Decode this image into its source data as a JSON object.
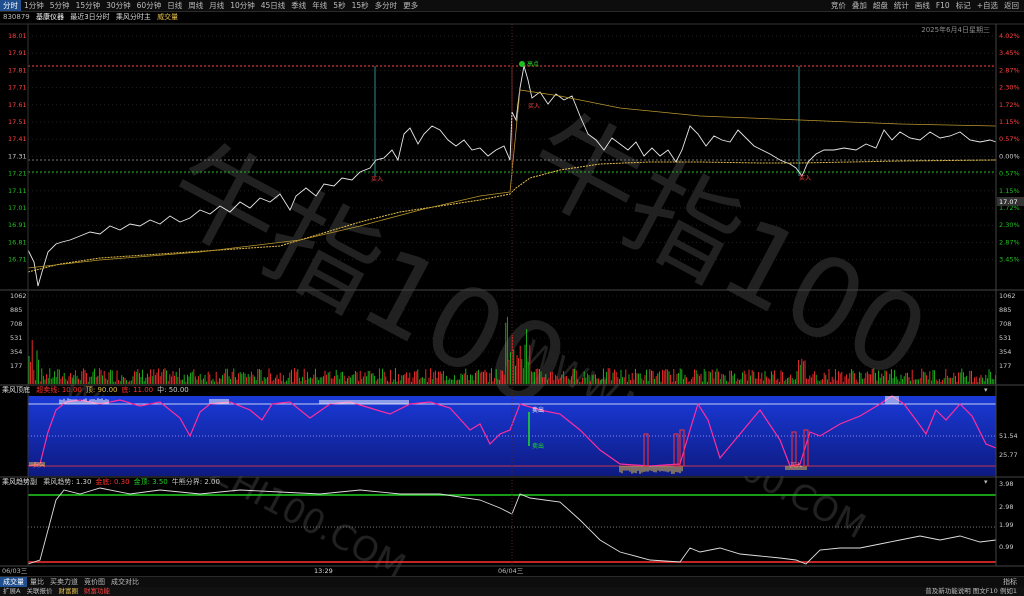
{
  "toolbar": {
    "tabs": [
      "分时",
      "1分钟",
      "5分钟",
      "15分钟",
      "30分钟",
      "60分钟",
      "日线",
      "周线",
      "月线",
      "10分钟",
      "45日线",
      "季线",
      "年线",
      "5秒",
      "15秒",
      "多分时",
      "更多"
    ],
    "active_tab": "分时",
    "right_buttons": [
      "竞价",
      "叠加",
      "超盘",
      "统计",
      "画线",
      "F10",
      "标记",
      "+自选",
      "返回"
    ]
  },
  "info": {
    "code": "830879",
    "name": "基康仪器",
    "period": "最近3日分时",
    "indicator_name": "乘风分时主",
    "indicator_vol": "威交量"
  },
  "date_caption": "2025年6月4日星期三",
  "price_axis": {
    "left": [
      "18.01",
      "17.91",
      "17.81",
      "17.71",
      "17.61",
      "17.51",
      "17.41",
      "17.31",
      "17.21",
      "17.11",
      "17.01",
      "16.91",
      "16.81",
      "16.71"
    ],
    "right": [
      "4.02%",
      "3.45%",
      "2.87%",
      "2.30%",
      "1.72%",
      "1.15%",
      "0.57%",
      "0.00%",
      "0.57%",
      "1.15%",
      "1.72%",
      "2.30%",
      "2.87%",
      "3.45%"
    ],
    "right_colors": [
      "#ff4040",
      "#ff4040",
      "#ff4040",
      "#ff4040",
      "#ff4040",
      "#ff4040",
      "#ff4040",
      "#cccccc",
      "#20c020",
      "#20c020",
      "#20c020",
      "#20c020",
      "#20c020",
      "#20c020"
    ],
    "current_price": "17.07"
  },
  "volume_axis": {
    "left": [
      "1062",
      "885",
      "708",
      "531",
      "354",
      "177"
    ],
    "right": [
      "1062",
      "885",
      "708",
      "531",
      "354",
      "177"
    ]
  },
  "signals": {
    "buy_labels": [
      "买入",
      "买入",
      "买入"
    ],
    "top_label": "高点"
  },
  "panel1": {
    "title": "乘风顶底",
    "params": [
      {
        "text": "超卖线: 10.00",
        "color": "#ff3030"
      },
      {
        "text": "顶: 90.00",
        "color": "#e6c04a"
      },
      {
        "text": "底: 11.00",
        "color": "#ff3030"
      },
      {
        "text": "中: 50.00",
        "color": "#cccccc"
      }
    ],
    "axis_right": [
      "51.54",
      "25.77"
    ],
    "labels": [
      "卖出",
      "买入",
      "卖出",
      "买入"
    ]
  },
  "panel2": {
    "title": "乘风趋势副",
    "params": [
      {
        "text": "乘风趋势: 1.30",
        "color": "#cccccc"
      },
      {
        "text": "金底: 0.30",
        "color": "#ff3030"
      },
      {
        "text": "金顶: 3.50",
        "color": "#20d020"
      },
      {
        "text": "牛熊分界: 2.00",
        "color": "#cccccc"
      }
    ],
    "axis_right": [
      "3.98",
      "2.98",
      "1.99",
      "0.99"
    ]
  },
  "time_axis": {
    "labels": [
      "06/03三",
      "13:29",
      "06/04三"
    ]
  },
  "bottom_tabs": [
    "成交量",
    "量比",
    "买卖力道",
    "竞价图",
    "成交对比"
  ],
  "bottom_right": "指标",
  "status": {
    "left": [
      {
        "text": "扩展A",
        "color": "#bdbdbd"
      },
      {
        "text": "关联报价",
        "color": "#bdbdbd"
      },
      {
        "text": "财富圈",
        "color": "#e6c04a"
      },
      {
        "text": "财富功能",
        "color": "#ff4040"
      }
    ],
    "right": "普及新功能说明 图文F10 例如1"
  },
  "colors": {
    "price_line": "#e8e8e8",
    "avg_line": "#e6c04a",
    "up": "#ff3030",
    "down": "#20c020",
    "panel1_bg": "#1a2fb8",
    "panel1_line": "#ff2d9e"
  },
  "watermark": "牛指100 WWW.NIUZHI100.COM"
}
